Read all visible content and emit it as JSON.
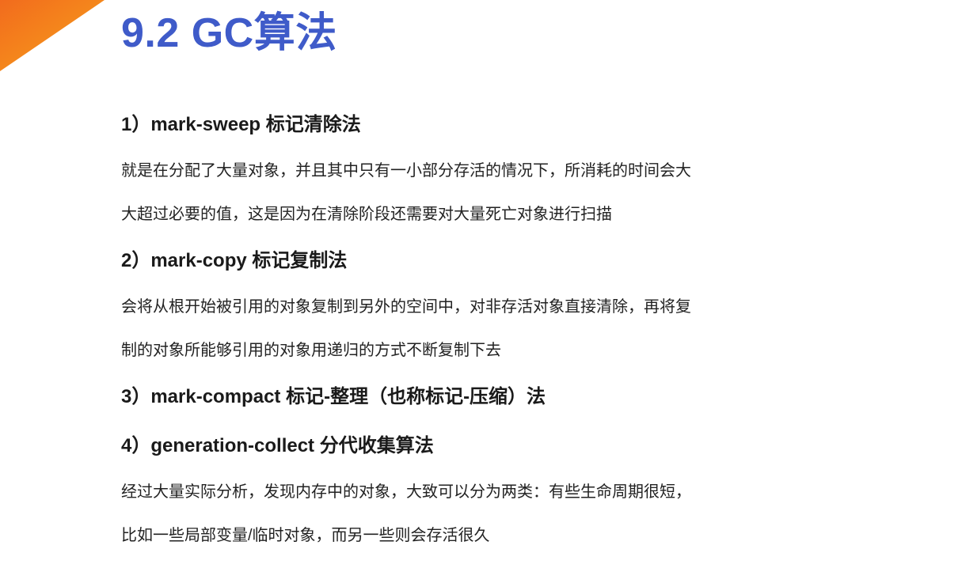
{
  "title": "9.2 GC算法",
  "colors": {
    "title": "#3f5bc9",
    "accent_corner": "#f08a1c"
  },
  "sections": [
    {
      "heading": "1）mark-sweep 标记清除法",
      "lines": [
        "就是在分配了大量对象，并且其中只有一小部分存活的情况下，所消耗的时间会大",
        "大超过必要的值，这是因为在清除阶段还需要对大量死亡对象进行扫描"
      ]
    },
    {
      "heading": "2）mark-copy 标记复制法",
      "lines": [
        "会将从根开始被引用的对象复制到另外的空间中，对非存活对象直接清除，再将复",
        "制的对象所能够引用的对象用递归的方式不断复制下去"
      ]
    },
    {
      "heading": "3）mark-compact 标记-整理（也称标记-压缩）法",
      "lines": []
    },
    {
      "heading": "4）generation-collect 分代收集算法",
      "lines": [
        "经过大量实际分析，发现内存中的对象，大致可以分为两类：有些生命周期很短，",
        "比如一些局部变量/临时对象，而另一些则会存活很久"
      ]
    }
  ]
}
